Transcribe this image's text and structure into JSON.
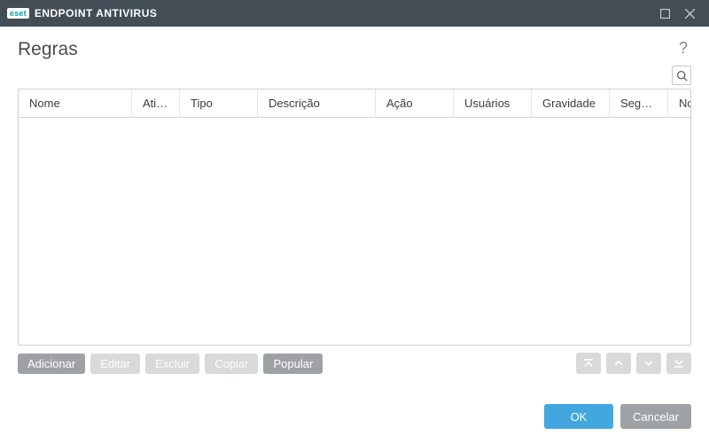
{
  "titlebar": {
    "brand_badge": "eset",
    "app_name_bold": "ENDPOINT ANTIVIRUS"
  },
  "page": {
    "title": "Regras",
    "help_tooltip": "?"
  },
  "table": {
    "columns": [
      {
        "label": "Nome",
        "width": 128
      },
      {
        "label": "Ativado",
        "width": 54
      },
      {
        "label": "Tipo",
        "width": 88
      },
      {
        "label": "Descrição",
        "width": 133
      },
      {
        "label": "Ação",
        "width": 88
      },
      {
        "label": "Usuários",
        "width": 88
      },
      {
        "label": "Gravidade",
        "width": 88
      },
      {
        "label": "Segmen...",
        "width": 66
      },
      {
        "label": "Notificar",
        "width": 88
      },
      {
        "label": "",
        "width": 80
      }
    ],
    "rows": []
  },
  "toolbar": {
    "add": "Adicionar",
    "edit": "Editar",
    "delete": "Excluir",
    "copy": "Copiar",
    "populate": "Popular"
  },
  "footer": {
    "ok": "OK",
    "cancel": "Cancelar"
  }
}
